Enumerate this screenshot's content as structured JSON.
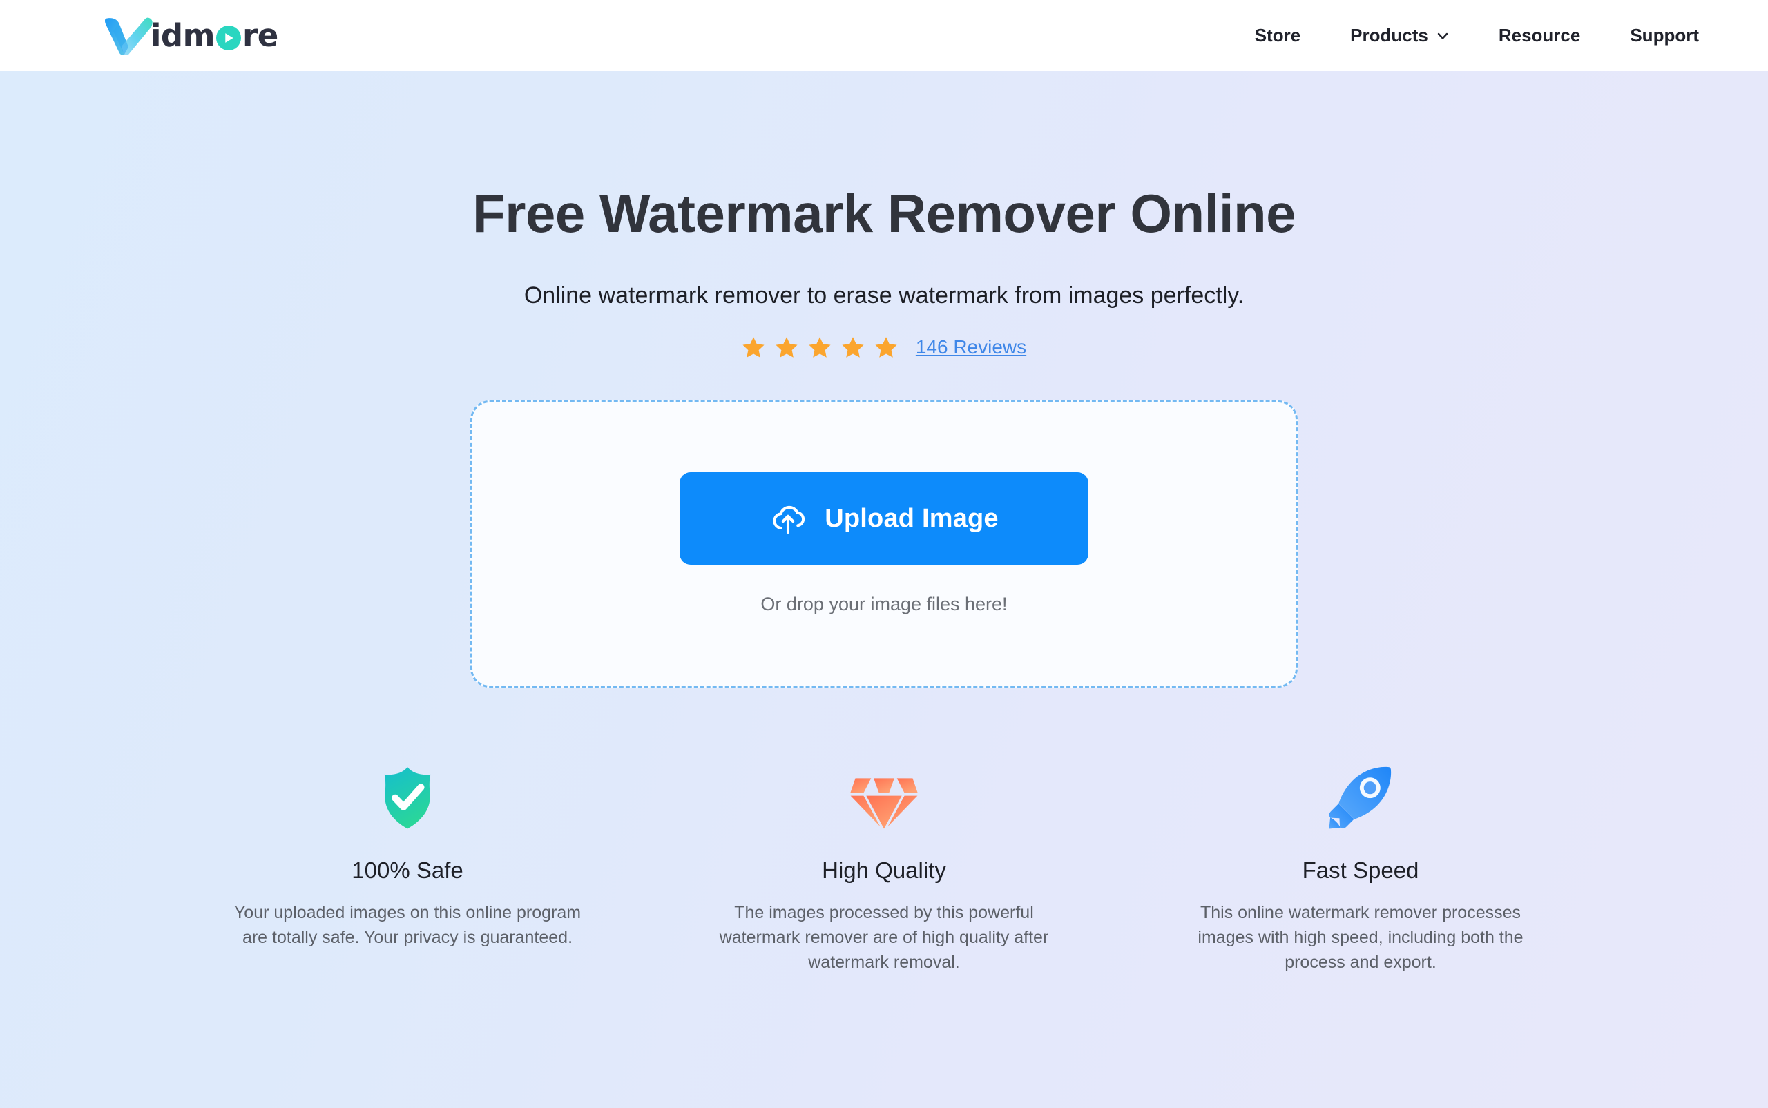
{
  "brand": {
    "name_pre": "idm",
    "name_post": "re",
    "logo_icon": "vidmore-checkmark-logo",
    "play_icon": "play-triangle-icon",
    "colors": {
      "logo_blue": "#1f9bf5",
      "logo_teal": "#2ad6c0",
      "logo_text": "#2f3241"
    }
  },
  "nav": {
    "items": [
      {
        "label": "Store",
        "has_dropdown": false
      },
      {
        "label": "Products",
        "has_dropdown": true,
        "icon": "chevron-down-icon"
      },
      {
        "label": "Resource",
        "has_dropdown": false
      },
      {
        "label": "Support",
        "has_dropdown": false
      }
    ]
  },
  "hero": {
    "title": "Free Watermark Remover Online",
    "subtitle": "Online watermark remover to erase watermark from images perfectly.",
    "rating": {
      "stars": 5,
      "star_icon": "star-icon",
      "star_color": "#fba52e",
      "reviews_label": "146 Reviews",
      "reviews_color": "#3f87e8"
    }
  },
  "dropzone": {
    "upload_button": {
      "label": "Upload Image",
      "icon": "cloud-upload-icon",
      "color": "#0d8bfb"
    },
    "hint": "Or drop your image files here!",
    "border_color": "#73b9f2"
  },
  "features": [
    {
      "icon": "shield-check-icon",
      "icon_color_start": "#15becd",
      "icon_color_end": "#2ad69a",
      "title": "100% Safe",
      "description": "Your uploaded images on this online program are totally safe. Your privacy is guaranteed."
    },
    {
      "icon": "diamond-icon",
      "icon_color_start": "#ff7a5c",
      "icon_color_end": "#ffa172",
      "title": "High Quality",
      "description": "The images processed by this powerful watermark remover are of high quality after watermark removal."
    },
    {
      "icon": "rocket-icon",
      "icon_color_start": "#1f86f8",
      "icon_color_end": "#56a9fb",
      "title": "Fast Speed",
      "description": "This online watermark remover processes images with high speed, including both the process and export."
    }
  ]
}
